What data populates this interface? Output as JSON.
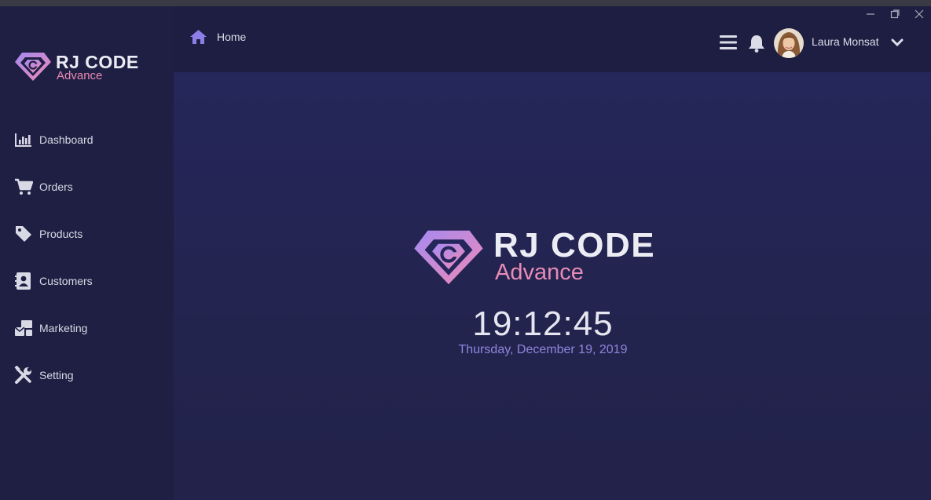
{
  "app": {
    "brand_title": "RJ CODE",
    "brand_subtitle": "Advance"
  },
  "colors": {
    "accent_purple": "#9b7cf0",
    "accent_pink": "#e88bb6",
    "sidebar_bg": "#1f1f43",
    "content_bg": "#24244a"
  },
  "sidebar": {
    "items": [
      {
        "label": "Dashboard",
        "icon": "bar-chart-icon"
      },
      {
        "label": "Orders",
        "icon": "shopping-cart-icon"
      },
      {
        "label": "Products",
        "icon": "tag-icon"
      },
      {
        "label": "Customers",
        "icon": "address-book-icon"
      },
      {
        "label": "Marketing",
        "icon": "mail-bulk-icon"
      },
      {
        "label": "Setting",
        "icon": "tools-icon"
      }
    ]
  },
  "header": {
    "breadcrumb": "Home",
    "breadcrumb_icon": "home-icon",
    "user_name": "Laura Monsat",
    "window_controls": [
      "minimize-icon",
      "restore-icon",
      "close-icon"
    ]
  },
  "main": {
    "time": "19:12:45",
    "date": "Thursday, December 19, 2019"
  }
}
